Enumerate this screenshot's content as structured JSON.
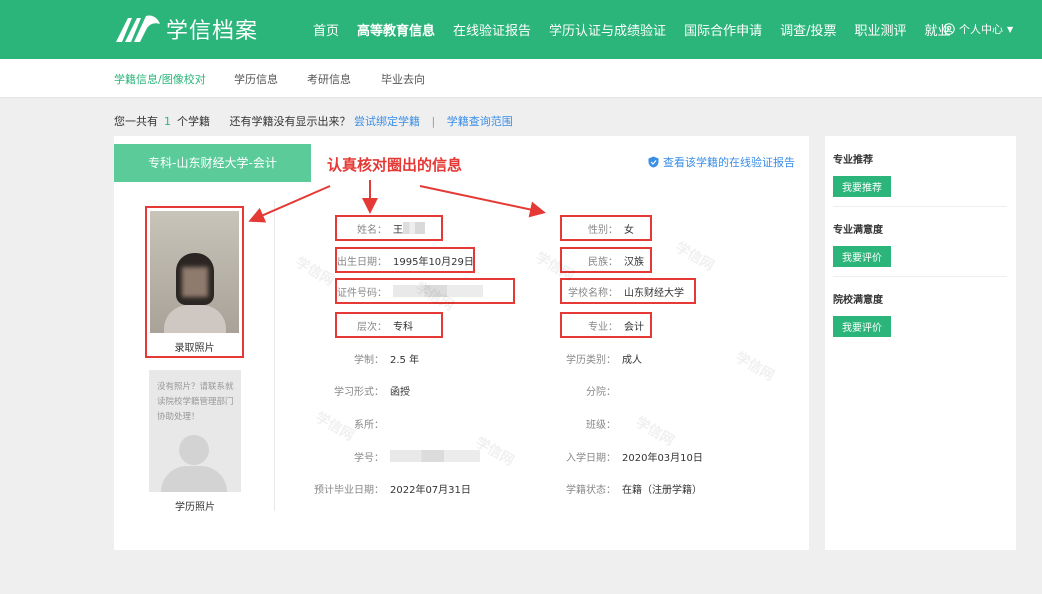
{
  "header": {
    "logo_text": "学信档案",
    "nav": [
      "首页",
      "高等教育信息",
      "在线验证报告",
      "学历认证与成绩验证",
      "国际合作申请",
      "调查/投票",
      "职业测评",
      "就业"
    ],
    "active_nav_index": 1,
    "user_label": "个人中心"
  },
  "subnav": [
    "学籍信息/图像校对",
    "学历信息",
    "考研信息",
    "毕业去向"
  ],
  "infoline": {
    "prefix": "您一共有",
    "count": "1",
    "suffix": "个学籍",
    "question": "还有学籍没有显示出来？",
    "bind_link": "尝试绑定学籍",
    "sep": "|",
    "scope_link": "学籍查询范围"
  },
  "record": {
    "tab_label": "专科-山东财经大学-会计",
    "verify_link": "查看该学籍的在线验证报告",
    "annotation": "认真核对圈出的信息",
    "photo_label": "录取照片",
    "nophoto_text": "没有照片？请联系就读院校学籍管理部门协助处理！",
    "nophoto_label": "学历照片",
    "left_fields": [
      {
        "label": "姓名：",
        "value": "王",
        "boxed": true,
        "masked": "name"
      },
      {
        "label": "出生日期：",
        "value": "1995年10月29日",
        "boxed": true
      },
      {
        "label": "证件号码：",
        "value": "",
        "boxed": true,
        "masked": "id"
      },
      {
        "label": "层次：",
        "value": "专科",
        "boxed": true
      },
      {
        "label": "学制：",
        "value": "2.5 年",
        "boxed": false
      },
      {
        "label": "学习形式：",
        "value": "函授",
        "boxed": false
      },
      {
        "label": "系所：",
        "value": "",
        "boxed": false
      },
      {
        "label": "学号：",
        "value": "",
        "boxed": false,
        "masked": "id"
      },
      {
        "label": "预计毕业日期：",
        "value": "2022年07月31日",
        "boxed": false
      }
    ],
    "right_fields": [
      {
        "label": "性别：",
        "value": "女",
        "boxed": true
      },
      {
        "label": "民族：",
        "value": "汉族",
        "boxed": true
      },
      {
        "label": "学校名称：",
        "value": "山东财经大学",
        "boxed": true
      },
      {
        "label": "专业：",
        "value": "会计",
        "boxed": true
      },
      {
        "label": "学历类别：",
        "value": "成人",
        "boxed": false
      },
      {
        "label": "分院：",
        "value": "",
        "boxed": false
      },
      {
        "label": "班级：",
        "value": "",
        "boxed": false
      },
      {
        "label": "入学日期：",
        "value": "2020年03月10日",
        "boxed": false
      },
      {
        "label": "学籍状态：",
        "value": "在籍（注册学籍）",
        "boxed": false
      }
    ],
    "watermark": "学信网"
  },
  "sidebar": [
    {
      "title": "专业推荐",
      "button": "我要推荐"
    },
    {
      "title": "专业满意度",
      "button": "我要评价"
    },
    {
      "title": "院校满意度",
      "button": "我要评价"
    }
  ],
  "colors": {
    "brand": "#2bb57a",
    "tab": "#5ccb9a",
    "link": "#3a8ee6",
    "annotation": "#e53935"
  }
}
